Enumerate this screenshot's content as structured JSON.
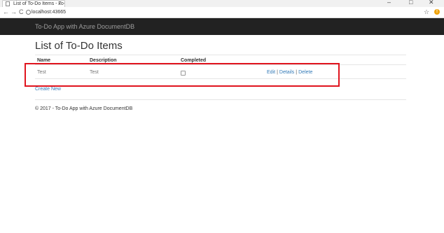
{
  "browser": {
    "tab_title": "List of To-Do Items - To-",
    "tab_close": "×",
    "window_controls": {
      "minimize": "–",
      "maximize": "□",
      "close": "✕"
    },
    "nav": {
      "back": "←",
      "forward": "→",
      "reload": "C"
    },
    "url": "localhost:43665",
    "star": "☆",
    "ext_badge": "!"
  },
  "navbar": {
    "brand": "To-Do App with Azure DocumentDB"
  },
  "page": {
    "title": "List of To-Do Items",
    "columns": [
      "Name",
      "Description",
      "Completed"
    ],
    "rows": [
      {
        "name": "Test",
        "description": "Test",
        "completed": false,
        "actions": {
          "edit": "Edit",
          "details": "Details",
          "delete": "Delete",
          "sep": "|"
        }
      }
    ],
    "create_new": "Create New",
    "footer": "© 2017 - To-Do App with Azure DocumentDB"
  },
  "colors": {
    "navbar": "#222222",
    "link": "#337ab7",
    "highlight": "#e0141e"
  }
}
